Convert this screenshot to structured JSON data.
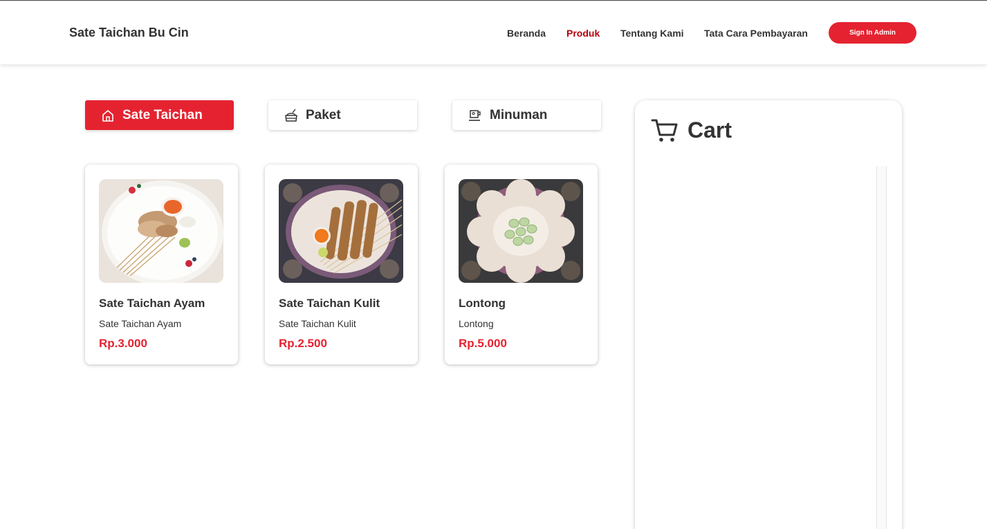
{
  "navbar": {
    "brand": "Sate Taichan Bu Cin",
    "links": [
      {
        "label": "Beranda",
        "active": false
      },
      {
        "label": "Produk",
        "active": true
      },
      {
        "label": "Tentang Kami",
        "active": false
      },
      {
        "label": "Tata Cara Pembayaran",
        "active": false
      }
    ],
    "signin_label": "Sign In Admin"
  },
  "tabs": [
    {
      "label": "Sate Taichan",
      "icon": "house-icon",
      "active": true
    },
    {
      "label": "Paket",
      "icon": "food-package-icon",
      "active": false
    },
    {
      "label": "Minuman",
      "icon": "drink-cup-icon",
      "active": false
    }
  ],
  "products": [
    {
      "name": "Sate Taichan Ayam",
      "description": "Sate Taichan Ayam",
      "price": "Rp.3.000",
      "image": "chicken-satay-plate-photo"
    },
    {
      "name": "Sate Taichan Kulit",
      "description": "Sate Taichan Kulit",
      "price": "Rp.2.500",
      "image": "skin-satay-plate-photo"
    },
    {
      "name": "Lontong",
      "description": "Lontong",
      "price": "Rp.5.000",
      "image": "lontong-plate-photo"
    }
  ],
  "cart": {
    "title": "Cart",
    "icon": "shopping-cart-icon"
  },
  "colors": {
    "accent": "#e52330",
    "active_nav": "#b5000c",
    "text": "#333333"
  }
}
